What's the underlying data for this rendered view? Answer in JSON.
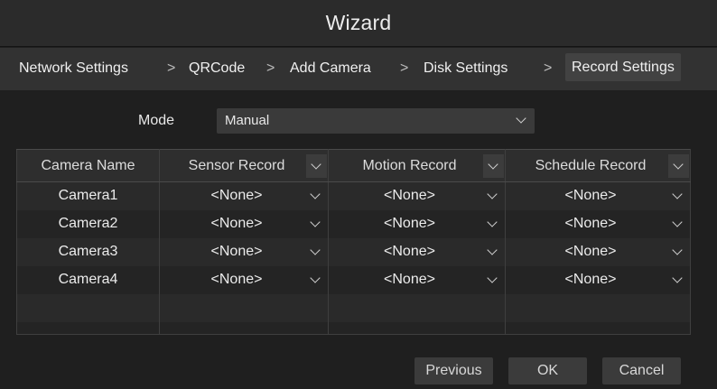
{
  "window": {
    "title": "Wizard"
  },
  "steps": [
    {
      "label": "Network Settings",
      "active": false
    },
    {
      "label": "QRCode",
      "active": false
    },
    {
      "label": "Add Camera",
      "active": false
    },
    {
      "label": "Disk Settings",
      "active": false
    },
    {
      "label": "Record Settings",
      "active": true
    }
  ],
  "step_separator": ">",
  "mode": {
    "label": "Mode",
    "value": "Manual"
  },
  "table": {
    "columns": [
      "Camera Name",
      "Sensor Record",
      "Motion Record",
      "Schedule Record"
    ],
    "rows": [
      {
        "name": "Camera1",
        "sensor": "<None>",
        "motion": "<None>",
        "schedule": "<None>"
      },
      {
        "name": "Camera2",
        "sensor": "<None>",
        "motion": "<None>",
        "schedule": "<None>"
      },
      {
        "name": "Camera3",
        "sensor": "<None>",
        "motion": "<None>",
        "schedule": "<None>"
      },
      {
        "name": "Camera4",
        "sensor": "<None>",
        "motion": "<None>",
        "schedule": "<None>"
      }
    ]
  },
  "buttons": {
    "previous": "Previous",
    "ok": "OK",
    "cancel": "Cancel"
  },
  "icons": {
    "dropdown": "chevron-down-icon"
  },
  "colors": {
    "background": "#1f1f1f",
    "titlebar": "#2b2b2b",
    "active_step": "#424242"
  }
}
